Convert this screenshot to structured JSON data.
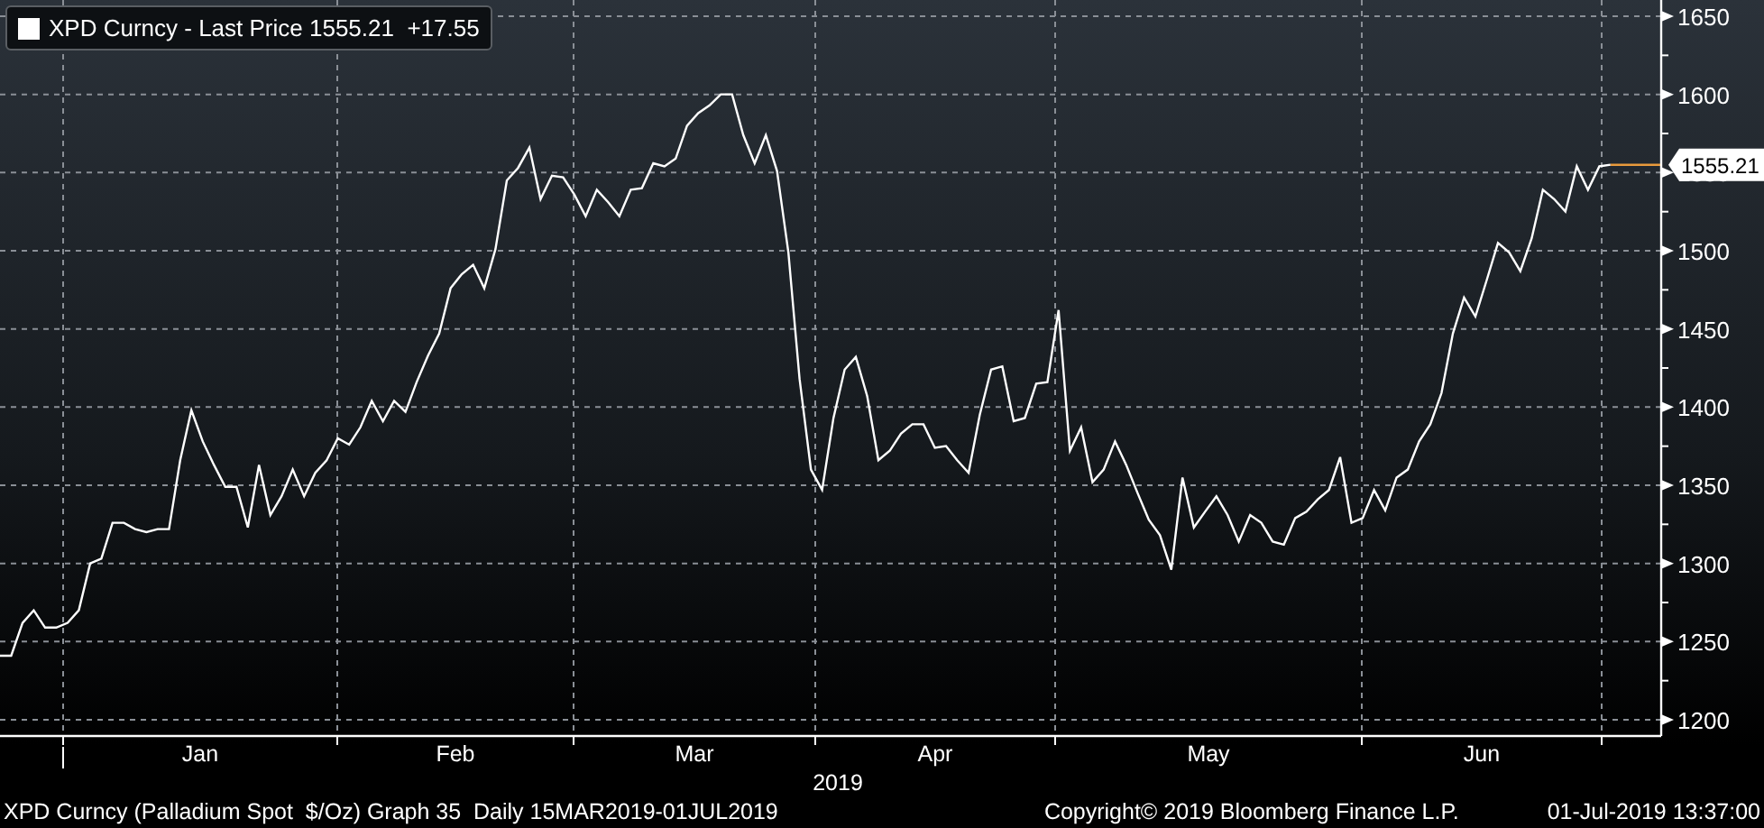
{
  "legend": {
    "label": "XPD Curncy -",
    "value": "1555.21",
    "change": "+17.55"
  },
  "chart": {
    "chart_data": {
      "type": "line",
      "grid": true,
      "ylim": [
        1189.6,
        1660.4
      ],
      "yticks": [
        1200,
        1250,
        1300,
        1350,
        1400,
        1450,
        1500,
        1550,
        1600,
        1650
      ],
      "series": [
        {
          "name": "Last Price",
          "color": "#ffffff",
          "values": [
            1241,
            1241,
            1262,
            1270,
            1259,
            1259,
            1262,
            1270,
            1300,
            1303,
            1326,
            1326,
            1322,
            1320,
            1322,
            1322,
            1366,
            1398,
            1378,
            1363,
            1349,
            1349,
            1323,
            1363,
            1331,
            1343,
            1360,
            1343,
            1358,
            1366,
            1380,
            1376,
            1387,
            1404,
            1391,
            1404,
            1397,
            1416,
            1433,
            1447,
            1476,
            1485,
            1491,
            1476,
            1501,
            1545,
            1553,
            1566,
            1533,
            1548,
            1547,
            1536,
            1522,
            1539,
            1531,
            1522,
            1539,
            1540,
            1556,
            1554,
            1559,
            1580,
            1588,
            1593,
            1600,
            1600,
            1574,
            1556,
            1574,
            1551,
            1499,
            1418,
            1360,
            1347,
            1393,
            1424,
            1432,
            1407,
            1366,
            1372,
            1383,
            1389,
            1389,
            1374,
            1375,
            1366,
            1358,
            1395,
            1424,
            1426,
            1391,
            1393,
            1415,
            1416,
            1462,
            1372,
            1387,
            1352,
            1360,
            1378,
            1363,
            1345,
            1328,
            1318,
            1296,
            1355,
            1323,
            1333,
            1343,
            1331,
            1314,
            1331,
            1326,
            1314,
            1312,
            1329,
            1333,
            1341,
            1347,
            1368,
            1326,
            1329,
            1347,
            1334,
            1355,
            1360,
            1378,
            1389,
            1409,
            1447,
            1470,
            1458,
            1481,
            1505,
            1499,
            1487,
            1508,
            1539,
            1533,
            1525,
            1554,
            1539,
            1554,
            1555
          ]
        }
      ]
    },
    "month_labels": [
      "Jan",
      "Feb",
      "Mar",
      "Apr",
      "May",
      "Jun"
    ],
    "year_label": "2019",
    "last_price_tag": "1555.21"
  },
  "footer": {
    "left": "XPD Curncy (Palladium Spot  $/Oz) Graph 35  Daily 15MAR2019-01JUL2019",
    "center": "Copyright© 2019 Bloomberg Finance L.P.",
    "right": "01-Jul-2019 13:37:00"
  }
}
